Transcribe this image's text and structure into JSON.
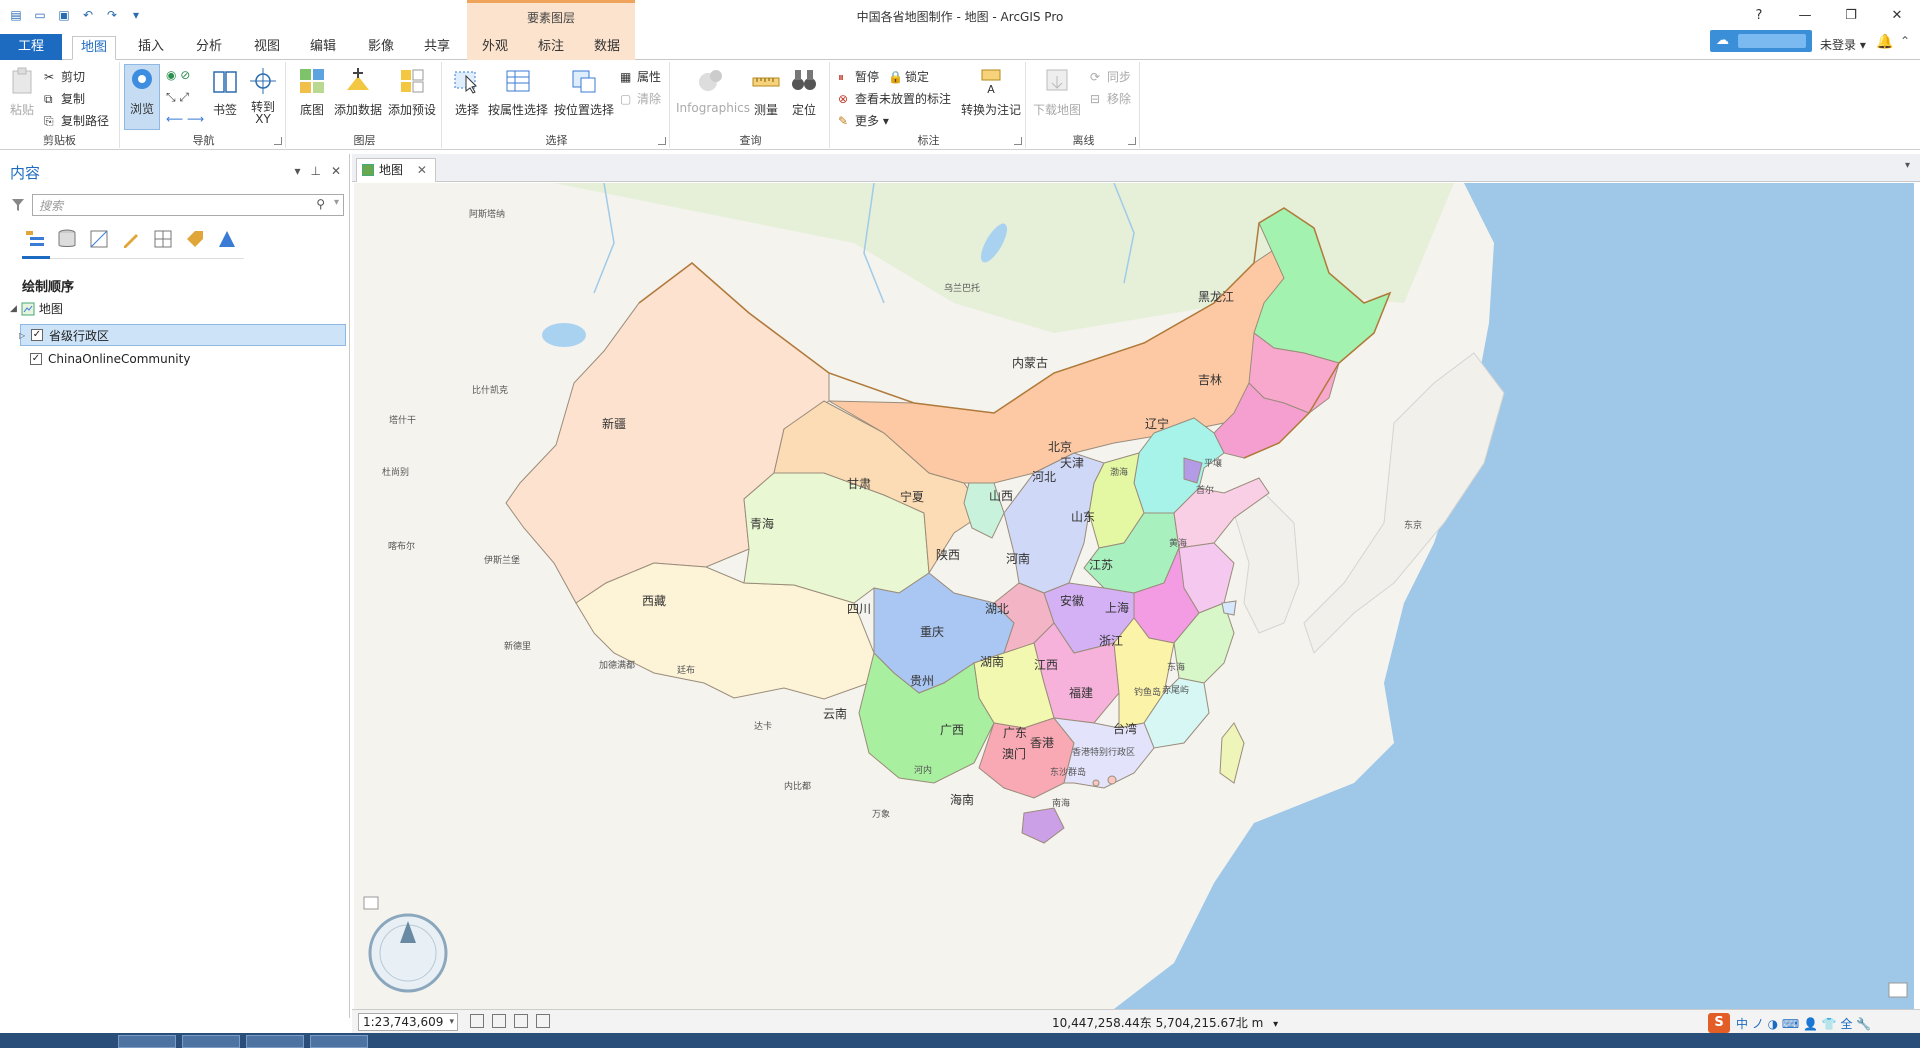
{
  "window": {
    "title": "中国各省地图制作 - 地图 - ArcGIS Pro",
    "context_group": "要素图层",
    "controls": [
      "?",
      "—",
      "❐",
      "✕"
    ]
  },
  "tabs": {
    "project": "工程",
    "items": [
      "地图",
      "插入",
      "分析",
      "视图",
      "编辑",
      "影像",
      "共享",
      "外观",
      "标注",
      "数据"
    ]
  },
  "account": {
    "not_signed_in": "未登录 ▾"
  },
  "ribbon": {
    "clipboard": {
      "label": "剪贴板",
      "paste": "粘贴",
      "cut": "剪切",
      "copy": "复制",
      "copy_path": "复制路径"
    },
    "navigate": {
      "label": "导航",
      "explore": "浏览",
      "bookmarks": "书签",
      "goto_xy": "转到 XY"
    },
    "layer": {
      "label": "图层",
      "basemap": "底图",
      "add_data": "添加数据",
      "add_preset": "添加预设"
    },
    "selection": {
      "label": "选择",
      "select": "选择",
      "select_by_attr": "按属性选择",
      "select_by_loc": "按位置选择",
      "attributes": "属性",
      "clear": "清除"
    },
    "inquiry": {
      "label": "查询",
      "infographics": "Infographics",
      "measure": "测量",
      "locate": "定位"
    },
    "labeling": {
      "label": "标注",
      "pause": "暂停",
      "lock": "锁定",
      "view_unplaced": "查看未放置的标注",
      "more": "更多 ▾",
      "convert": "转换为注记"
    },
    "offline": {
      "label": "离线",
      "download": "下载地图",
      "sync": "同步",
      "remove": "移除"
    }
  },
  "contents_pane": {
    "title": "内容",
    "controls": [
      "▾",
      "⊥",
      "✕"
    ],
    "search_placeholder": "搜索",
    "section_title": "绘制顺序",
    "map_node": "地图",
    "layers": [
      {
        "name": "省级行政区",
        "checked": true,
        "selected": true
      },
      {
        "name": "ChinaOnlineCommunity",
        "checked": true,
        "selected": false
      }
    ]
  },
  "map_view": {
    "tab_label": "地图",
    "scale": "1:23,743,609",
    "coordinates": "10,447,258.44东 5,704,215.67北 m",
    "provinces": [
      {
        "name": "新疆",
        "color": "#fde2cf"
      },
      {
        "name": "西藏",
        "color": "#fdf3d6"
      },
      {
        "name": "青海",
        "color": "#eaf7d3"
      },
      {
        "name": "甘肃",
        "color": "#fcdcb5"
      },
      {
        "name": "内蒙古",
        "color": "#fdc9a4"
      },
      {
        "name": "黑龙江",
        "color": "#a3f2b0"
      },
      {
        "name": "吉林",
        "color": "#f8a8cc"
      },
      {
        "name": "辽宁",
        "color": "#f59fd0"
      },
      {
        "name": "北京",
        "color": "#a7f3ea"
      },
      {
        "name": "天津",
        "color": "#b49be5"
      },
      {
        "name": "河北",
        "color": "#a7f3ea"
      },
      {
        "name": "山西",
        "color": "#e4f7a3"
      },
      {
        "name": "宁夏",
        "color": "#c8f2dc"
      },
      {
        "name": "陕西",
        "color": "#d0d8f7"
      },
      {
        "name": "河南",
        "color": "#a9f0bf"
      },
      {
        "name": "山东",
        "color": "#f9cfe5"
      },
      {
        "name": "江苏",
        "color": "#f5c9ef"
      },
      {
        "name": "安徽",
        "color": "#f39be3"
      },
      {
        "name": "上海",
        "color": "#d6e8ff"
      },
      {
        "name": "四川",
        "color": "#aac6f2"
      },
      {
        "name": "重庆",
        "color": "#f3b4c6"
      },
      {
        "name": "湖北",
        "color": "#d4b1f4"
      },
      {
        "name": "湖南",
        "color": "#f6b2da"
      },
      {
        "name": "江西",
        "color": "#fbf3a8"
      },
      {
        "name": "浙江",
        "color": "#d7f7c8"
      },
      {
        "name": "福建",
        "color": "#d6f7f3"
      },
      {
        "name": "贵州",
        "color": "#f3f8b1"
      },
      {
        "name": "云南",
        "color": "#a8efa0"
      },
      {
        "name": "广西",
        "color": "#f8a9b4"
      },
      {
        "name": "广东",
        "color": "#e3e3fb"
      },
      {
        "name": "香港",
        "color": "#fcc7c1"
      },
      {
        "name": "澳门",
        "color": "#fcc7c1"
      },
      {
        "name": "海南",
        "color": "#cba0e6"
      },
      {
        "name": "台湾",
        "color": "#eff5b8"
      }
    ],
    "basemap_labels": [
      "阿斯塔纳",
      "乌兰巴托",
      "比什凯克",
      "塔什干",
      "杜尚别",
      "喀布尔",
      "伊斯兰堡",
      "新德里",
      "加德满都",
      "廷布",
      "达卡",
      "河内",
      "内比都",
      "万象",
      "平壤",
      "首尔",
      "东京",
      "黄海",
      "东海",
      "渤海",
      "南海",
      "钓鱼岛",
      "赤尾屿",
      "东沙群岛",
      "香港特别行政区"
    ]
  },
  "ime": {
    "logo": "S",
    "text": "中 ノ ◑ ⌨ 👤 👕 全 🔧"
  }
}
